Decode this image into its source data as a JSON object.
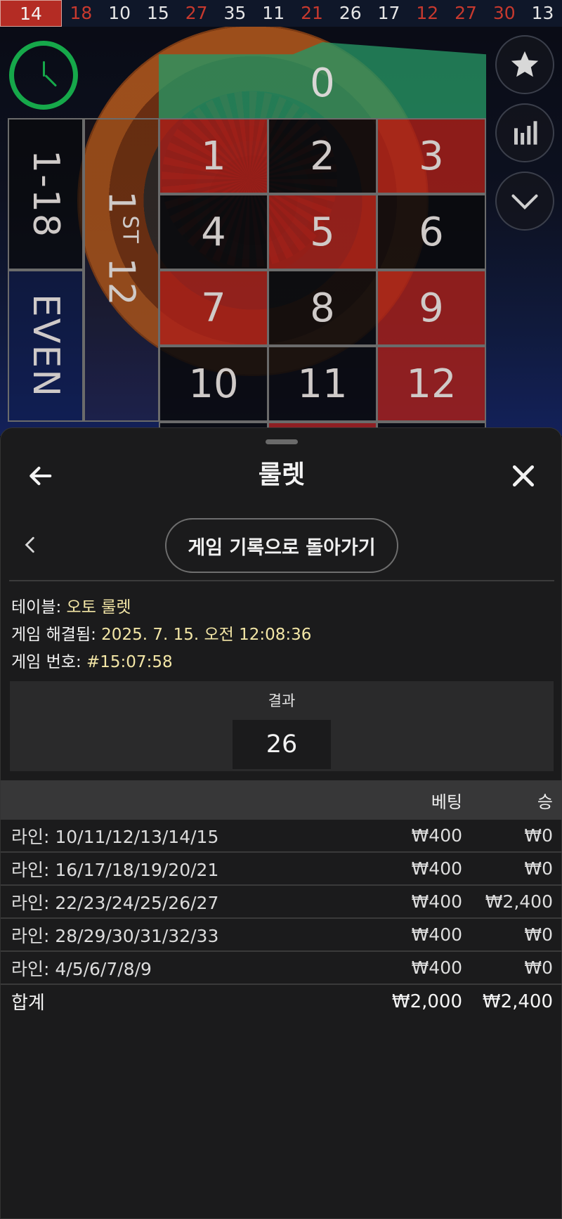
{
  "history": {
    "latest": "14",
    "numbers": [
      {
        "value": "18",
        "color": "red"
      },
      {
        "value": "10",
        "color": "black"
      },
      {
        "value": "15",
        "color": "black"
      },
      {
        "value": "27",
        "color": "red"
      },
      {
        "value": "35",
        "color": "black"
      },
      {
        "value": "11",
        "color": "black"
      },
      {
        "value": "21",
        "color": "red"
      },
      {
        "value": "26",
        "color": "black"
      },
      {
        "value": "17",
        "color": "black"
      },
      {
        "value": "12",
        "color": "red"
      },
      {
        "value": "27",
        "color": "red"
      },
      {
        "value": "30",
        "color": "red"
      },
      {
        "value": "13",
        "color": "black"
      }
    ]
  },
  "board": {
    "zero": "0",
    "low": "1-18",
    "even": "EVEN",
    "dozen_number": "1",
    "dozen_suffix": "ST",
    "dozen_value": "12",
    "rows": [
      [
        {
          "n": "1",
          "c": "red"
        },
        {
          "n": "2",
          "c": "black"
        },
        {
          "n": "3",
          "c": "red"
        }
      ],
      [
        {
          "n": "4",
          "c": "black"
        },
        {
          "n": "5",
          "c": "red"
        },
        {
          "n": "6",
          "c": "black"
        }
      ],
      [
        {
          "n": "7",
          "c": "red"
        },
        {
          "n": "8",
          "c": "black"
        },
        {
          "n": "9",
          "c": "red"
        }
      ],
      [
        {
          "n": "10",
          "c": "black"
        },
        {
          "n": "11",
          "c": "black"
        },
        {
          "n": "12",
          "c": "red"
        }
      ]
    ]
  },
  "icons": {
    "favorite": "star-icon",
    "stats": "bar-chart-icon",
    "collapse": "chevron-down-icon",
    "timer": "clock-icon"
  },
  "colors": {
    "red": "#b42c24",
    "green": "#16a84a",
    "accent_text": "#f3e6a6"
  },
  "sheet": {
    "title": "룰렛",
    "history_back_label": "게임 기록으로 돌아가기",
    "table_label": "테이블: ",
    "table_value": "오토 룰렛",
    "settled_label": "게임 해결됨: ",
    "settled_value": "2025. 7. 15. 오전 12:08:36",
    "number_label": "게임 번호: ",
    "number_value": "#15:07:58",
    "result_label": "결과",
    "result_value": "26"
  },
  "bets": {
    "header_bet": "베팅",
    "header_win": "승",
    "rows": [
      {
        "name": "라인: 10/11/12/13/14/15",
        "bet": "₩400",
        "win": "₩0"
      },
      {
        "name": "라인: 16/17/18/19/20/21",
        "bet": "₩400",
        "win": "₩0"
      },
      {
        "name": "라인: 22/23/24/25/26/27",
        "bet": "₩400",
        "win": "₩2,400"
      },
      {
        "name": "라인: 28/29/30/31/32/33",
        "bet": "₩400",
        "win": "₩0"
      },
      {
        "name": "라인: 4/5/6/7/8/9",
        "bet": "₩400",
        "win": "₩0"
      }
    ],
    "total_label": "합계",
    "total_bet": "₩2,000",
    "total_win": "₩2,400"
  }
}
